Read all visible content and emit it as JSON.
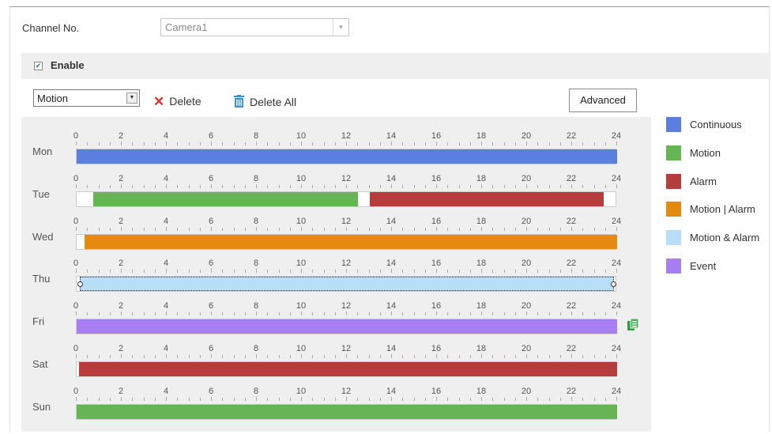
{
  "channel": {
    "label": "Channel No.",
    "value": "Camera1"
  },
  "enable": {
    "label": "Enable",
    "checked": true
  },
  "toolbar": {
    "record_type": "Motion",
    "delete_label": "Delete",
    "delete_all_label": "Delete All",
    "advanced_label": "Advanced"
  },
  "ticks": [
    "0",
    "2",
    "4",
    "6",
    "8",
    "10",
    "12",
    "14",
    "16",
    "18",
    "20",
    "22",
    "24"
  ],
  "colors": {
    "continuous": "#5b7fe0",
    "motion": "#66b554",
    "alarm": "#b73d3d",
    "motion_or_alarm": "#e38a0f",
    "motion_and_alarm": "#b9defa",
    "event": "#a77ff2"
  },
  "schedule": [
    {
      "day": "Mon",
      "segments": [
        {
          "start": 0,
          "end": 24,
          "type": "continuous"
        }
      ]
    },
    {
      "day": "Tue",
      "segments": [
        {
          "start": 0.75,
          "end": 12.5,
          "type": "motion"
        },
        {
          "start": 13,
          "end": 23.4,
          "type": "alarm"
        }
      ]
    },
    {
      "day": "Wed",
      "segments": [
        {
          "start": 0.35,
          "end": 24,
          "type": "motion_or_alarm"
        }
      ]
    },
    {
      "day": "Thu",
      "segments": [
        {
          "start": 0.15,
          "end": 23.85,
          "type": "motion_and_alarm",
          "selected": true
        }
      ]
    },
    {
      "day": "Fri",
      "segments": [
        {
          "start": 0,
          "end": 24,
          "type": "event"
        }
      ]
    },
    {
      "day": "Sat",
      "segments": [
        {
          "start": 0.1,
          "end": 24,
          "type": "alarm"
        }
      ]
    },
    {
      "day": "Sun",
      "segments": [
        {
          "start": 0,
          "end": 24,
          "type": "motion"
        }
      ]
    }
  ],
  "legend": [
    {
      "label": "Continuous",
      "type": "continuous"
    },
    {
      "label": "Motion",
      "type": "motion"
    },
    {
      "label": "Alarm",
      "type": "alarm"
    },
    {
      "label": "Motion | Alarm",
      "type": "motion_or_alarm"
    },
    {
      "label": "Motion & Alarm",
      "type": "motion_and_alarm"
    },
    {
      "label": "Event",
      "type": "event"
    }
  ],
  "icons": {
    "delete": "x-icon",
    "delete_all": "trash-icon",
    "copy": "copy-icon",
    "dropdown": "chevron-down-icon",
    "check": "checkbox-icon"
  }
}
